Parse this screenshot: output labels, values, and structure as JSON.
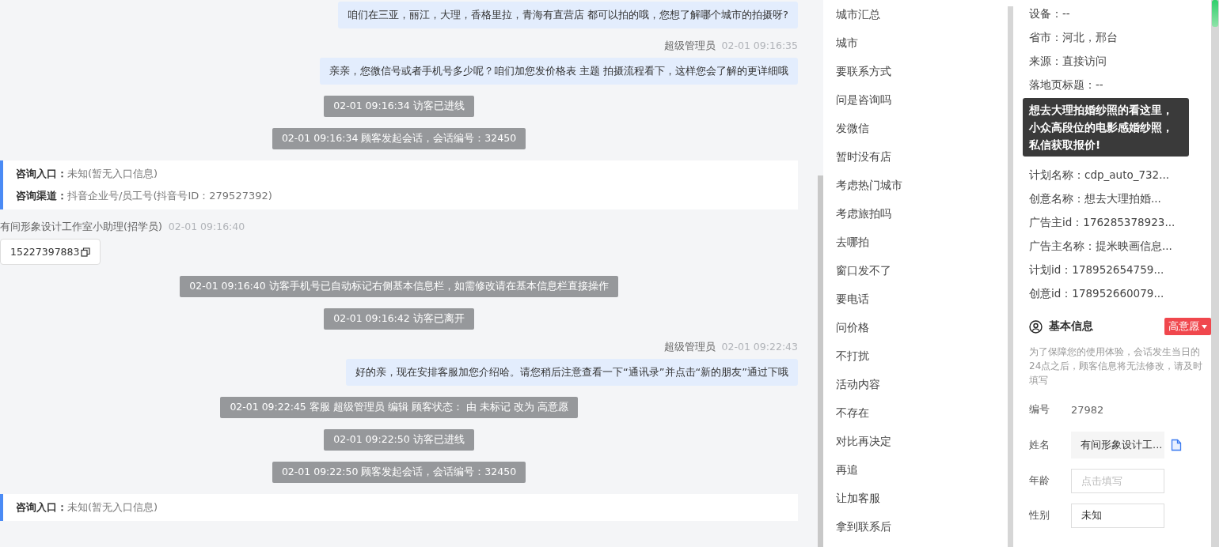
{
  "chat": {
    "messages": [
      {
        "kind": "agent",
        "text": "咱们在三亚，丽江，大理，香格里拉，青海有直营店 都可以拍的哦，您想了解哪个城市的拍摄呀?"
      },
      {
        "kind": "agent",
        "sender": "超级管理员",
        "time": "02-01 09:16:35",
        "text": "亲亲，您微信号或者手机号多少呢？咱们加您发价格表 主题 拍摄流程看下，这样您会了解的更详细哦"
      },
      {
        "kind": "system",
        "text": "02-01 09:16:34 访客已进线"
      },
      {
        "kind": "system",
        "text": "02-01 09:16:34 顾客发起会话，会话编号：32450"
      },
      {
        "kind": "info",
        "rows": [
          {
            "label": "咨询入口：",
            "value": "未知(暂无入口信息)"
          },
          {
            "label": "咨询渠道：",
            "value": "抖音企业号/员工号(抖音号ID：279527392)"
          }
        ]
      },
      {
        "kind": "visitor",
        "sender": "有间形象设计工作室小助理(招学员)",
        "time": "02-01 09:16:40",
        "text": "15227397883"
      },
      {
        "kind": "system",
        "text": "02-01 09:16:40 访客手机号已自动标记右侧基本信息栏，如需修改请在基本信息栏直接操作"
      },
      {
        "kind": "system",
        "text": "02-01 09:16:42 访客已离开"
      },
      {
        "kind": "agent",
        "sender": "超级管理员",
        "time": "02-01 09:22:43",
        "text": "好的亲，现在安排客服加您介绍哈。请您稍后注意查看一下“通讯录”并点击“新的朋友”通过下哦"
      },
      {
        "kind": "system",
        "text": "02-01 09:22:45 客服 超级管理员 编辑 顾客状态： 由 未标记 改为 高意愿"
      },
      {
        "kind": "system",
        "text": "02-01 09:22:50 访客已进线"
      },
      {
        "kind": "system",
        "text": "02-01 09:22:50 顾客发起会话，会话编号：32450"
      },
      {
        "kind": "info",
        "rows": [
          {
            "label": "咨询入口：",
            "value": "未知(暂无入口信息)"
          }
        ]
      }
    ]
  },
  "quick_replies": [
    "城市汇总",
    "城市",
    "要联系方式",
    "问是咨询吗",
    "发微信",
    "暂时没有店",
    "考虑热门城市",
    "考虑旅拍吗",
    "去哪拍",
    "窗口发不了",
    "要电话",
    "问价格",
    "不打扰",
    "活动内容",
    "不存在",
    "对比再决定",
    "再追",
    "让加客服",
    "拿到联系后"
  ],
  "details": {
    "rows": [
      "设备：--",
      "省市：河北，邢台",
      "来源：直接访问",
      "落地页标题：--",
      "计划名称：cdp_auto_732...",
      "创意名称：想去大理拍婚...",
      "广告主id：176285378923...",
      "广告主名称：提米映画信息...",
      "计划id：178952654759...",
      "创意id：178952660079..."
    ],
    "tooltip": "想去大理拍婚纱照的看这里，小众高段位的电影感婚纱照，私信获取报价!"
  },
  "basic_info": {
    "title": "基本信息",
    "tag": "高意愿",
    "note": "为了保障您的使用体验，会话发生当日的24点之后，顾客信息将无法修改，请及时填写",
    "fields": [
      {
        "kind": "static",
        "label": "编号",
        "value": "27982"
      },
      {
        "kind": "filled",
        "label": "姓名",
        "value": "有间形象设计工..."
      },
      {
        "kind": "input",
        "label": "年龄",
        "placeholder": "点击填写"
      },
      {
        "kind": "input",
        "label": "性别",
        "value": "未知"
      }
    ]
  }
}
